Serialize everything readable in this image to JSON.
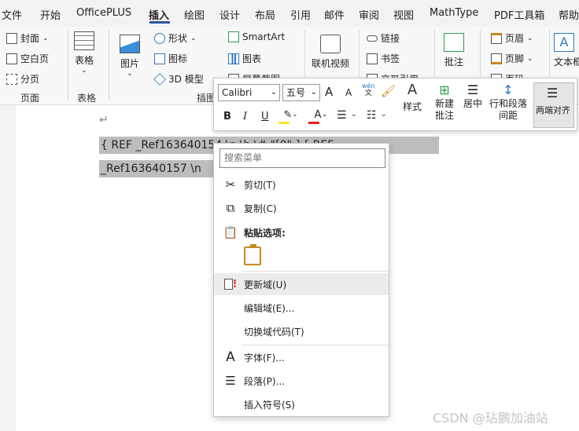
{
  "menu_tabs": [
    "文件",
    "开始",
    "OfficePLUS",
    "插入",
    "绘图",
    "设计",
    "布局",
    "引用",
    "邮件",
    "审阅",
    "视图",
    "MathType",
    "PDF工具箱",
    "帮助"
  ],
  "active_tab": "插入",
  "ribbon": {
    "page_group": {
      "items": [
        "封面",
        "空白页",
        "分页"
      ],
      "label": "页面"
    },
    "table_group": {
      "button": "表格",
      "label": "表格"
    },
    "illustrations": {
      "picture": "图片",
      "shapes": "形状",
      "icons": "图标",
      "model3d": "3D 模型",
      "smartart": "SmartArt",
      "chart": "图表",
      "screenshot": "屏幕截图",
      "label": "插图"
    },
    "online_video": "联机视频",
    "links": {
      "link": "链接",
      "bookmark": "书签",
      "crossref": "交叉引用"
    },
    "comment": "批注",
    "header_footer": {
      "header": "页眉",
      "footer": "页脚",
      "page_number": "页码"
    },
    "text_box": "文本框"
  },
  "mini_toolbar": {
    "font": "Calibri",
    "size": "五号",
    "grow": "A",
    "shrink": "A",
    "phonetic_top": "wén",
    "phonetic_bottom": "文",
    "bold": "B",
    "italic": "I",
    "underline": "U",
    "font_color": "A",
    "styles": "样式",
    "new_comment_1": "新建",
    "new_comment_2": "批注",
    "center": "居中",
    "line_spacing_1": "行和段落",
    "line_spacing_2": "间距",
    "justify": "两端对齐"
  },
  "document": {
    "paragraph_mark": "↵",
    "field_line1": "{  REF  _Ref163640154  \\n  \\h  \\#  \"[0\"  }{  REF",
    "field_line2": "_Ref163640157 \\n"
  },
  "context_menu": {
    "search_placeholder": "搜索菜单",
    "cut": "剪切(T)",
    "copy": "复制(C)",
    "paste_options": "粘贴选项:",
    "update_field": "更新域(U)",
    "edit_field": "编辑域(E)...",
    "toggle_field_codes": "切换域代码(T)",
    "font": "字体(F)...",
    "paragraph": "段落(P)...",
    "insert_symbol": "插入符号(S)"
  },
  "watermark": "CSDN @玷鹏加油站",
  "colors": {
    "accent": "#2b579a",
    "highlight": "#f5e32a",
    "font_color": "#e02020",
    "update_icon": "#d83a3a",
    "paste_icon": "#c88a1c"
  }
}
